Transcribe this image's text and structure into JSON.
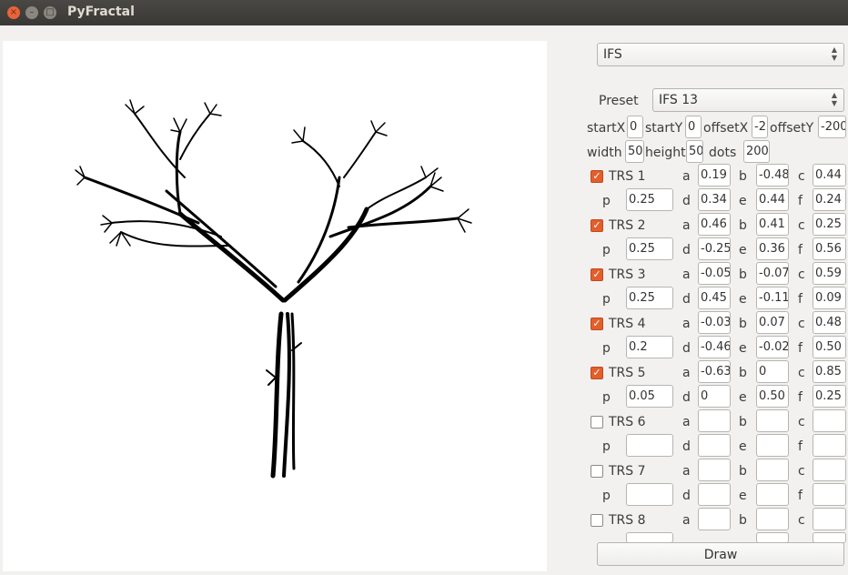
{
  "window": {
    "title": "PyFractal"
  },
  "fractal_type": "IFS",
  "preset": {
    "label": "Preset",
    "value": "IFS 13"
  },
  "params": {
    "startX": {
      "label": "startX",
      "value": "0"
    },
    "startY": {
      "label": "startY",
      "value": "0"
    },
    "offsetX": {
      "label": "offsetX",
      "value": "-2"
    },
    "offsetY": {
      "label": "offsetY",
      "value": "-200"
    },
    "width": {
      "label": "width",
      "value": "50"
    },
    "height": {
      "label": "height",
      "value": "50"
    },
    "dots": {
      "label": "dots",
      "value": "200"
    }
  },
  "trs": [
    {
      "name": "TRS 1",
      "checked": true,
      "a": "0.19",
      "b": "-0.48",
      "c": "0.44",
      "p": "0.25",
      "d": "0.34",
      "e": "0.44",
      "f": "0.24"
    },
    {
      "name": "TRS 2",
      "checked": true,
      "a": "0.46",
      "b": "0.41",
      "c": "0.25",
      "p": "0.25",
      "d": "-0.25",
      "e": "0.36",
      "f": "0.56"
    },
    {
      "name": "TRS 3",
      "checked": true,
      "a": "-0.05",
      "b": "-0.07",
      "c": "0.59",
      "p": "0.25",
      "d": "0.45",
      "e": "-0.11",
      "f": "0.09"
    },
    {
      "name": "TRS 4",
      "checked": true,
      "a": "-0.03",
      "b": "0.07",
      "c": "0.48",
      "p": "0.2",
      "d": "-0.46",
      "e": "-0.02",
      "f": "0.50"
    },
    {
      "name": "TRS 5",
      "checked": true,
      "a": "-0.63",
      "b": "0",
      "c": "0.85",
      "p": "0.05",
      "d": "0",
      "e": "0.50",
      "f": "0.25"
    },
    {
      "name": "TRS 6",
      "checked": false,
      "a": "",
      "b": "",
      "c": "",
      "p": "",
      "d": "",
      "e": "",
      "f": ""
    },
    {
      "name": "TRS 7",
      "checked": false,
      "a": "",
      "b": "",
      "c": "",
      "p": "",
      "d": "",
      "e": "",
      "f": ""
    },
    {
      "name": "TRS 8",
      "checked": false,
      "a": "",
      "b": "",
      "c": "",
      "p": "",
      "d": "",
      "e": "",
      "f": ""
    }
  ],
  "coef_labels": {
    "a": "a",
    "b": "b",
    "c": "c",
    "p": "p",
    "d": "d",
    "e": "e",
    "f": "f"
  },
  "draw_label": "Draw"
}
